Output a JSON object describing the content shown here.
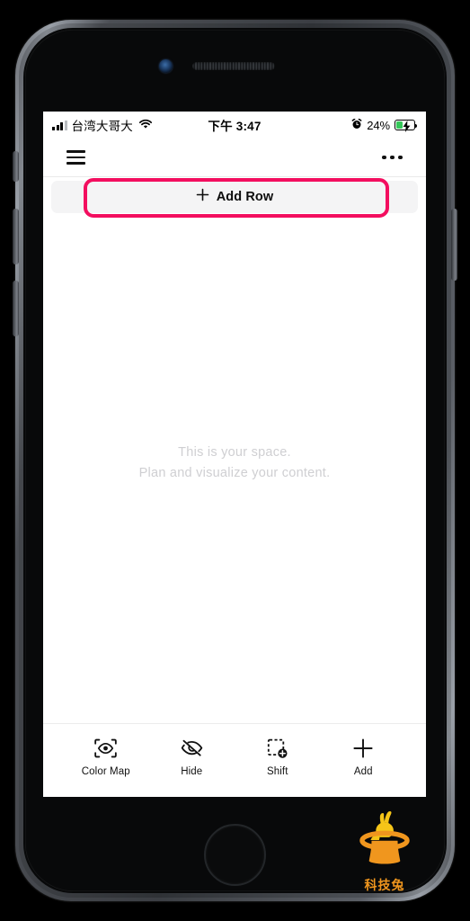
{
  "device": {
    "name": "iphone-space-gray",
    "camera_icon": "front-camera",
    "speaker_icon": "earpiece-speaker",
    "home_button_label": "Home"
  },
  "status_bar": {
    "carrier": "台湾大哥大",
    "signal_icon": "cellular-signal-icon",
    "signal_bars_filled": 3,
    "signal_bars_total": 4,
    "wifi_icon": "wifi-icon",
    "time": "下午 3:47",
    "alarm_icon": "alarm-clock-icon",
    "battery_percent": "24%",
    "battery_icon": "battery-charging-icon",
    "battery_level": 24,
    "battery_color": "#35c759",
    "charging": true
  },
  "nav_bar": {
    "menu_icon": "hamburger-menu-icon",
    "more_icon": "more-options-icon"
  },
  "add_row": {
    "plus_icon": "plus-icon",
    "label": "Add Row",
    "background_color": "#f4f4f5",
    "highlight_color": "#f30e5f"
  },
  "canvas": {
    "empty_state": {
      "line1": "This is your space.",
      "line2": "Plan and visualize your content.",
      "text_color": "#cfcfd2"
    }
  },
  "toolbar": {
    "items": [
      {
        "label": "Color Map",
        "icon": "color-map-eye-icon"
      },
      {
        "label": "Hide",
        "icon": "eye-slash-icon"
      },
      {
        "label": "Shift",
        "icon": "shift-dashed-square-plus-icon"
      },
      {
        "label": "Add",
        "icon": "plus-icon"
      }
    ]
  },
  "watermark": {
    "name": "科技兔",
    "icon": "rabbit-in-top-hat-logo",
    "rabbit_color": "#f5c518",
    "hat_color": "#f0961e"
  }
}
